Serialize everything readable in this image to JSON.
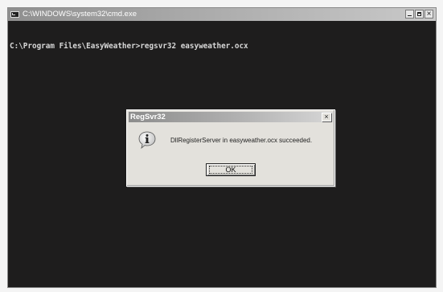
{
  "cmd_window": {
    "title": "C:\\WINDOWS\\system32\\cmd.exe",
    "prompt_line": "C:\\Program Files\\EasyWeather>regsvr32 easyweather.ocx"
  },
  "dialog": {
    "title": "RegSvr32",
    "close_label": "×",
    "message": "DllRegisterServer in easyweather.ocx succeeded.",
    "ok_label": "OK"
  },
  "icons": {
    "cmd_icon": "console-icon",
    "dialog_icon": "info-icon"
  }
}
